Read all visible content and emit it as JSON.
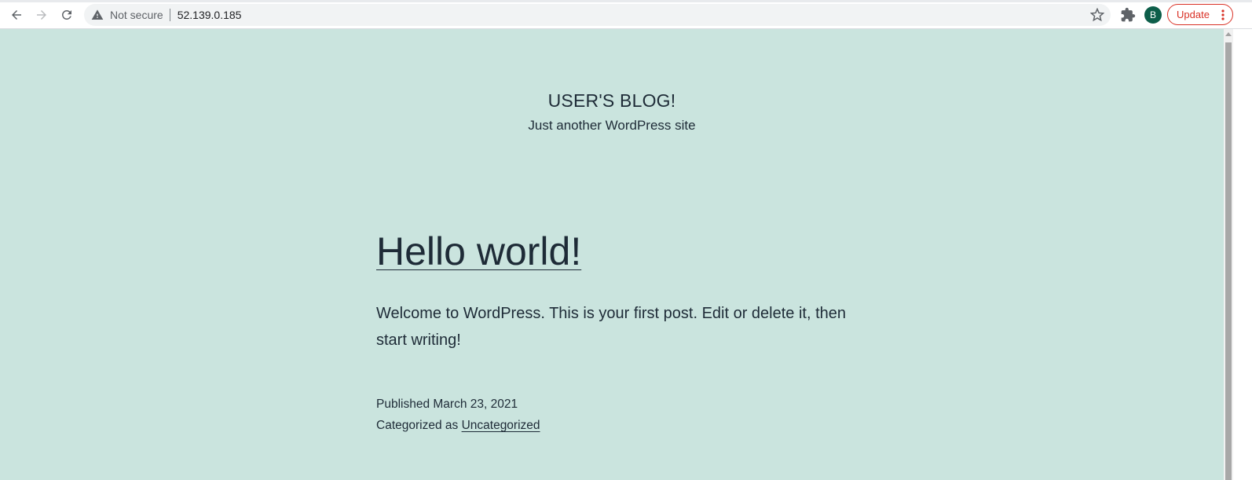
{
  "browser": {
    "security_label": "Not secure",
    "url": "52.139.0.185",
    "avatar_letter": "B",
    "update_label": "Update"
  },
  "site": {
    "title": "USER'S BLOG!",
    "tagline": "Just another WordPress site"
  },
  "post": {
    "title": "Hello world!",
    "content": "Welcome to WordPress. This is your first post. Edit or delete it, then start writing!",
    "published_prefix": "Published",
    "published_date": "March 23, 2021",
    "category_prefix": "Categorized as",
    "category": "Uncategorized"
  },
  "colors": {
    "page_background": "#cae4de",
    "text": "#1e2b37",
    "update_accent": "#d93025",
    "avatar_background": "#0d5e4a"
  },
  "icons": {
    "back": "back-arrow-icon",
    "forward": "forward-arrow-icon",
    "reload": "reload-icon",
    "warning": "warning-triangle-icon",
    "bookmark": "star-icon",
    "extensions": "puzzle-icon",
    "menu": "kebab-menu-icon"
  }
}
